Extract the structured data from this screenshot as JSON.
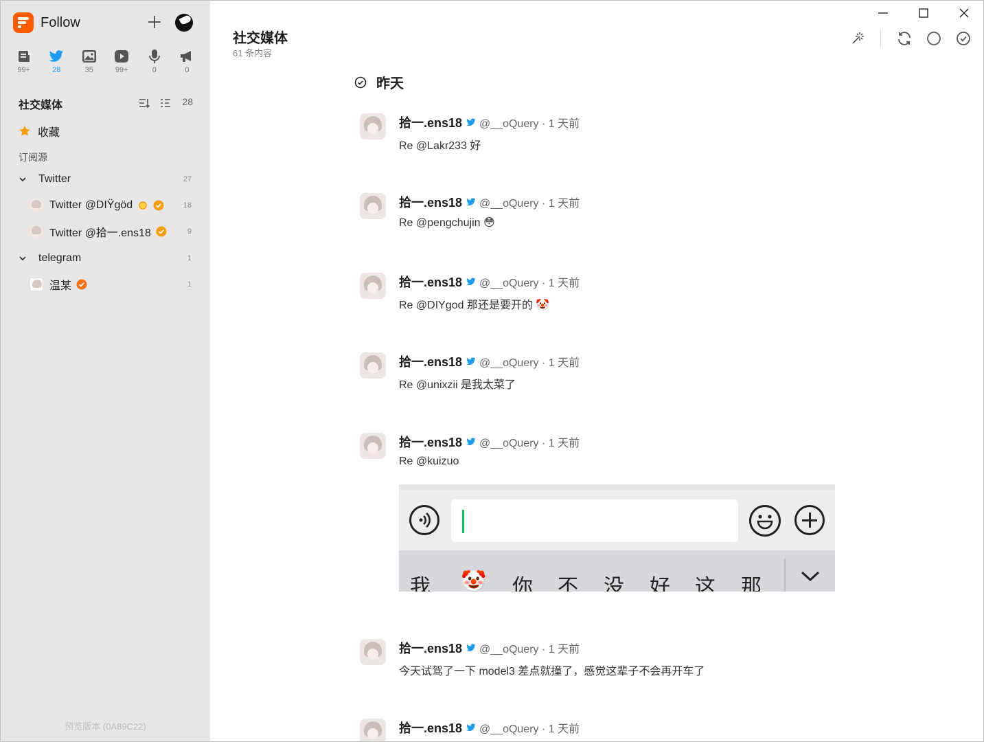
{
  "app": {
    "name": "Follow"
  },
  "views": [
    {
      "icon": "article-icon",
      "count": "99+"
    },
    {
      "icon": "twitter-icon",
      "count": "28"
    },
    {
      "icon": "picture-icon",
      "count": "35"
    },
    {
      "icon": "video-icon",
      "count": "99+"
    },
    {
      "icon": "microphone-icon",
      "count": "0"
    },
    {
      "icon": "megaphone-icon",
      "count": "0"
    }
  ],
  "sidebar": {
    "section_title": "社交媒体",
    "section_count": "28",
    "favorites_label": "收藏",
    "subscriptions_label": "订阅源",
    "groups": [
      {
        "label": "Twitter",
        "count": "27",
        "feeds": [
          {
            "label": "Twitter @DIŸgöd",
            "count": "18"
          },
          {
            "label": "Twitter @拾一.ens18",
            "count": "9"
          }
        ]
      },
      {
        "label": "telegram",
        "count": "1",
        "feeds": [
          {
            "label": "温某",
            "count": "1"
          }
        ]
      }
    ],
    "version": "预览版本 (0A89C22)"
  },
  "main": {
    "title": "社交媒体",
    "subtitle": "61 条内容",
    "date_label": "昨天"
  },
  "entries": [
    {
      "author": "拾一.ens18",
      "handle": "@__oQuery · 1 天前",
      "text": "Re @Lakr233 好"
    },
    {
      "author": "拾一.ens18",
      "handle": "@__oQuery · 1 天前",
      "text": "Re @pengchujin 😳"
    },
    {
      "author": "拾一.ens18",
      "handle": "@__oQuery · 1 天前",
      "text": "Re @DIYgod 那还是要开的 🤡"
    },
    {
      "author": "拾一.ens18",
      "handle": "@__oQuery · 1 天前",
      "text": "Re @unixzii 是我太菜了"
    },
    {
      "author": "拾一.ens18",
      "handle": "@__oQuery · 1 天前",
      "text": "Re @kuizuo"
    },
    {
      "author": "拾一.ens18",
      "handle": "@__oQuery · 1 天前",
      "text": "今天试驾了一下 model3 差点就撞了，感觉这辈子不会再开车了"
    },
    {
      "author": "拾一.ens18",
      "handle": "@__oQuery · 1 天前",
      "text": ""
    }
  ],
  "ime_candidates": [
    "我",
    "🤡",
    "你",
    "不",
    "没",
    "好",
    "这",
    "那"
  ],
  "colors": {
    "accent": "#ff5c00",
    "twitter": "#1d9bf0",
    "verified": "#f59e0b",
    "ime_caret": "#07c160"
  }
}
